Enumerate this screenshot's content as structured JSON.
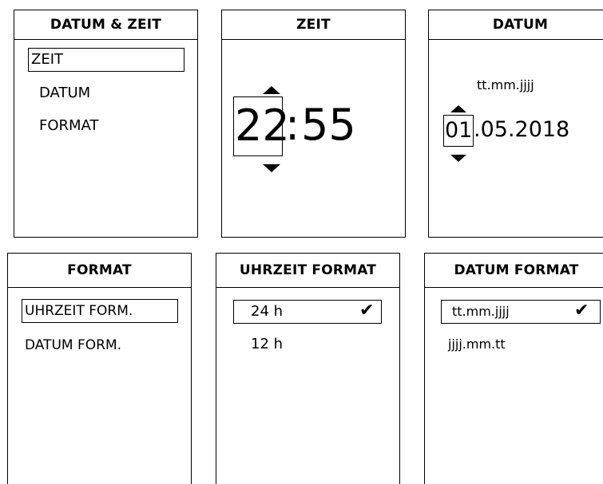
{
  "datum_zeit": {
    "title": "DATUM & ZEIT",
    "items": [
      "ZEIT",
      "DATUM",
      "FORMAT"
    ]
  },
  "zeit": {
    "title": "ZEIT",
    "hours": "22",
    "separator": ":",
    "minutes": "55"
  },
  "datum": {
    "title": "DATUM",
    "format_hint": "tt.mm.jjjj",
    "day": "01",
    "rest": ".05.2018"
  },
  "format": {
    "title": "FORMAT",
    "items": [
      "UHRZEIT FORM.",
      "DATUM FORM."
    ]
  },
  "uhrzeit_format": {
    "title": "UHRZEIT FORMAT",
    "options": [
      "24 h",
      "12 h"
    ],
    "checkmark": "✔"
  },
  "datum_format": {
    "title": "DATUM FORMAT",
    "options": [
      "tt.mm.jjjj",
      "jjjj.mm.tt"
    ],
    "checkmark": "✔"
  }
}
